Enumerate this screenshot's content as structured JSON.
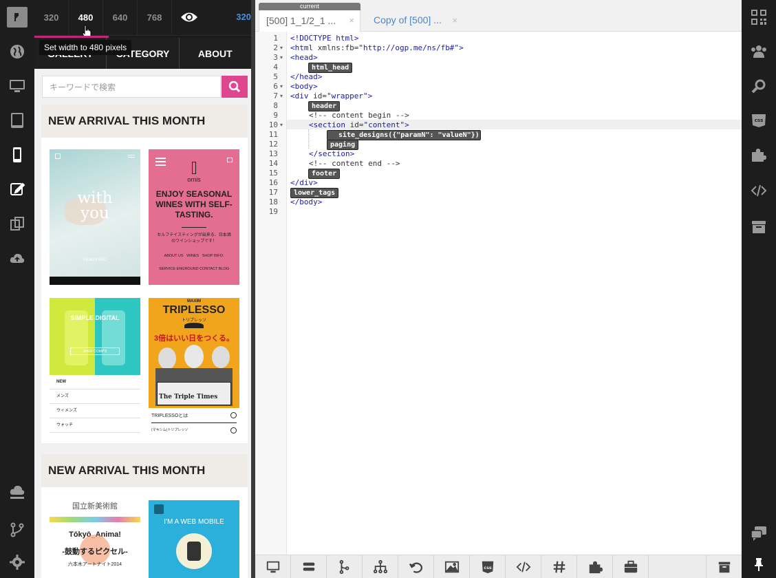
{
  "preview": {
    "widths": [
      "320",
      "480",
      "640",
      "768"
    ],
    "current_width": "320",
    "tooltip": "Set width to 480 pixels",
    "nav": [
      "GALLERY",
      "CATEGORY",
      "ABOUT"
    ],
    "search_placeholder": "キーワードで検索",
    "sections": [
      {
        "title": "NEW ARRIVAL THIS MONTH"
      },
      {
        "title": "NEW ARRIVAL THIS MONTH"
      }
    ],
    "thumbs": {
      "t1_line1": "with",
      "t1_line2": "you",
      "t1_sub": "VENUS BED",
      "t2_logo": "ornis",
      "t2_head": "ENJOY SEASONAL WINES WITH SELF-TASTING.",
      "t2_jp": "セルフテイスティングが出来る、日本酒のワインショップです！",
      "t2_links": "ABOUT US   WINES   SHOP INFO.",
      "t2_links2": "SERVICE  ENGROUND  CONTACT  BLOG",
      "t3_title": "SIMPLE DIGITAL",
      "t3_btn": "SHOP COMP'S",
      "t3_items": [
        "NEW",
        "メンズ",
        "ウィメンズ",
        "ウォッチ"
      ],
      "t4_top": "MAXIM",
      "t4_title": "TRIPLESSO",
      "t4_sub": "トリプレッソ",
      "t4_copy": "3倍はいい日をつくる。",
      "t4_paper": "The Triple Times",
      "t4_link1": "TRIPLESSOとは",
      "t4_link2": "(マキシム)トリプレッソ",
      "t5_top": "国立新美術館",
      "t5_title": "Tōkyō_Anima!",
      "t5_sub": "-鼓動するピクセル-",
      "t5_foot": "六本木アートナイト2014",
      "t6_title": "I'M A WEB MOBILE"
    }
  },
  "editor": {
    "current_badge": "current",
    "tabs": [
      {
        "label": "[500] 1_1/2_1 ...",
        "close": "×"
      },
      {
        "label": "Copy of [500] ...",
        "close": "×"
      }
    ],
    "line_numbers": [
      "1",
      "2",
      "3",
      "4",
      "5",
      "6",
      "7",
      "8",
      "9",
      "10",
      "11",
      "12",
      "13",
      "14",
      "15",
      "16",
      "17",
      "18",
      "19"
    ],
    "lines": {
      "l1": "<!DOCTYPE html>",
      "l2a": "<html ",
      "l2b": "xmlns:fb=",
      "l2c": "\"http://ogp.me/ns/fb#\"",
      "l2d": ">",
      "l3": "<head>",
      "l5": "</head>",
      "l6": "<body>",
      "l7a": "<div ",
      "l7b": "id=",
      "l7c": "\"wrapper\"",
      "l7d": ">",
      "l9": "<!-- content begin -->",
      "l10a": "<section ",
      "l10b": "id=",
      "l10c": "\"content\"",
      "l10d": ">",
      "l13": "</section>",
      "l14": "<!-- content end -->",
      "l16": "</div>",
      "l18": "</body>"
    },
    "template_tags": {
      "html_head": "html_head",
      "header": "header",
      "site_designs": "site_designs({\"paramN\": \"valueN\"})",
      "paging": "paging",
      "footer": "footer",
      "lower_tags": "lower_tags"
    }
  },
  "icons": {
    "left_rail": [
      "logo-icon",
      "globe-icon",
      "desktop-icon",
      "tablet-icon",
      "mobile-icon",
      "edit-icon",
      "copy-icon",
      "cloud-upload-icon",
      "upload-icon",
      "branch-icon",
      "gear-icon"
    ],
    "right_rail": [
      "qr-code-icon",
      "users-icon",
      "search-icon",
      "css-icon",
      "puzzle-icon",
      "code-icon",
      "archive-icon",
      "chat-icon",
      "pin-icon"
    ],
    "bottom_bar": [
      "desktop-icon",
      "menu-icon",
      "tree-icon",
      "sitemap-icon",
      "undo-icon",
      "image-icon",
      "css-icon",
      "code-icon",
      "hash-icon",
      "puzzle-icon",
      "briefcase-icon",
      "archive-icon"
    ],
    "bottom_css_label": "css",
    "right_css_label": "css"
  }
}
